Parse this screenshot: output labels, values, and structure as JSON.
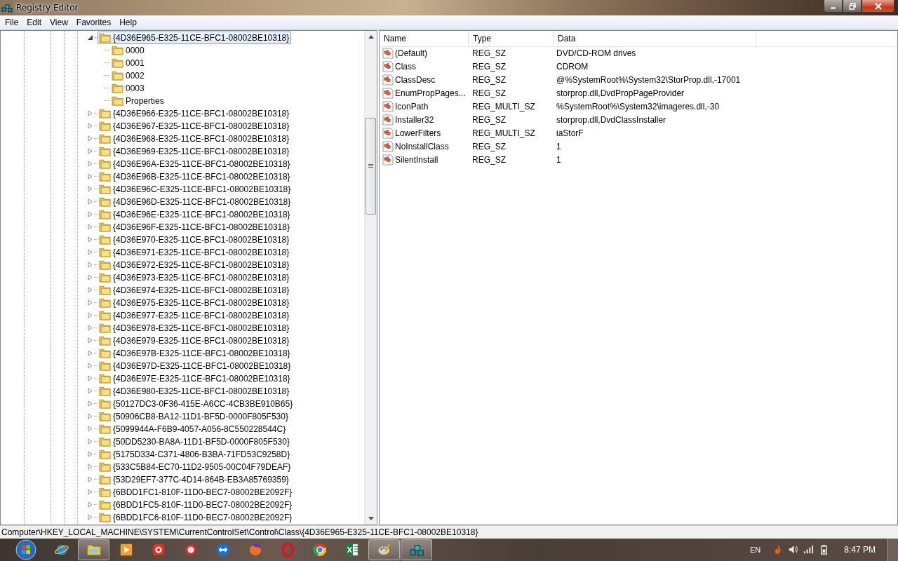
{
  "window": {
    "title": "Registry Editor"
  },
  "menu": [
    "File",
    "Edit",
    "View",
    "Favorites",
    "Help"
  ],
  "tree": {
    "items": [
      {
        "label": "{4D36E965-E325-11CE-BFC1-08002BE10318}",
        "expanded": true,
        "selected": true,
        "children": [
          {
            "label": "0000",
            "selected": false
          },
          {
            "label": "0001",
            "selected": false
          },
          {
            "label": "0002",
            "selected": false
          },
          {
            "label": "0003",
            "selected": false
          },
          {
            "label": "Properties",
            "selected": false
          }
        ]
      },
      {
        "label": "{4D36E966-E325-11CE-BFC1-08002BE10318}",
        "expanded": false,
        "selected": false
      },
      {
        "label": "{4D36E967-E325-11CE-BFC1-08002BE10318}",
        "expanded": false,
        "selected": false
      },
      {
        "label": "{4D36E968-E325-11CE-BFC1-08002BE10318}",
        "expanded": false,
        "selected": false
      },
      {
        "label": "{4D36E969-E325-11CE-BFC1-08002BE10318}",
        "expanded": false,
        "selected": false
      },
      {
        "label": "{4D36E96A-E325-11CE-BFC1-08002BE10318}",
        "expanded": false,
        "selected": false
      },
      {
        "label": "{4D36E96B-E325-11CE-BFC1-08002BE10318}",
        "expanded": false,
        "selected": false
      },
      {
        "label": "{4D36E96C-E325-11CE-BFC1-08002BE10318}",
        "expanded": false,
        "selected": false
      },
      {
        "label": "{4D36E96D-E325-11CE-BFC1-08002BE10318}",
        "expanded": false,
        "selected": false
      },
      {
        "label": "{4D36E96E-E325-11CE-BFC1-08002BE10318}",
        "expanded": false,
        "selected": false
      },
      {
        "label": "{4D36E96F-E325-11CE-BFC1-08002BE10318}",
        "expanded": false,
        "selected": false
      },
      {
        "label": "{4D36E970-E325-11CE-BFC1-08002BE10318}",
        "expanded": false,
        "selected": false
      },
      {
        "label": "{4D36E971-E325-11CE-BFC1-08002BE10318}",
        "expanded": false,
        "selected": false
      },
      {
        "label": "{4D36E972-E325-11CE-BFC1-08002BE10318}",
        "expanded": false,
        "selected": false
      },
      {
        "label": "{4D36E973-E325-11CE-BFC1-08002BE10318}",
        "expanded": false,
        "selected": false
      },
      {
        "label": "{4D36E974-E325-11CE-BFC1-08002BE10318}",
        "expanded": false,
        "selected": false
      },
      {
        "label": "{4D36E975-E325-11CE-BFC1-08002BE10318}",
        "expanded": false,
        "selected": false
      },
      {
        "label": "{4D36E977-E325-11CE-BFC1-08002BE10318}",
        "expanded": false,
        "selected": false
      },
      {
        "label": "{4D36E978-E325-11CE-BFC1-08002BE10318}",
        "expanded": false,
        "selected": false
      },
      {
        "label": "{4D36E979-E325-11CE-BFC1-08002BE10318}",
        "expanded": false,
        "selected": false
      },
      {
        "label": "{4D36E97B-E325-11CE-BFC1-08002BE10318}",
        "expanded": false,
        "selected": false
      },
      {
        "label": "{4D36E97D-E325-11CE-BFC1-08002BE10318}",
        "expanded": false,
        "selected": false
      },
      {
        "label": "{4D36E97E-E325-11CE-BFC1-08002BE10318}",
        "expanded": false,
        "selected": false
      },
      {
        "label": "{4D36E980-E325-11CE-BFC1-08002BE10318}",
        "expanded": false,
        "selected": false
      },
      {
        "label": "{50127DC3-0F36-415E-A6CC-4CB3BE910B65}",
        "expanded": false,
        "selected": false
      },
      {
        "label": "{50906CB8-BA12-11D1-BF5D-0000F805F530}",
        "expanded": false,
        "selected": false
      },
      {
        "label": "{5099944A-F6B9-4057-A056-8C550228544C}",
        "expanded": false,
        "selected": false
      },
      {
        "label": "{50DD5230-BA8A-11D1-BF5D-0000F805F530}",
        "expanded": false,
        "selected": false
      },
      {
        "label": "{5175D334-C371-4806-B3BA-71FD53C9258D}",
        "expanded": false,
        "selected": false
      },
      {
        "label": "{533C5B84-EC70-11D2-9505-00C04F79DEAF}",
        "expanded": false,
        "selected": false
      },
      {
        "label": "{53D29EF7-377C-4D14-864B-EB3A85769359}",
        "expanded": false,
        "selected": false
      },
      {
        "label": "{6BDD1FC1-810F-11D0-BEC7-08002BE2092F}",
        "expanded": false,
        "selected": false
      },
      {
        "label": "{6BDD1FC5-810F-11D0-BEC7-08002BE2092F}",
        "expanded": false,
        "selected": false
      },
      {
        "label": "{6BDD1FC6-810F-11D0-BEC7-08002BE2092F}",
        "expanded": false,
        "selected": false
      }
    ]
  },
  "values": {
    "columns": [
      "Name",
      "Type",
      "Data"
    ],
    "rows": [
      {
        "name": "(Default)",
        "type": "REG_SZ",
        "data": "DVD/CD-ROM drives"
      },
      {
        "name": "Class",
        "type": "REG_SZ",
        "data": "CDROM"
      },
      {
        "name": "ClassDesc",
        "type": "REG_SZ",
        "data": "@%SystemRoot%\\System32\\StorProp.dll,-17001"
      },
      {
        "name": "EnumPropPages...",
        "type": "REG_SZ",
        "data": "storprop.dll,DvdPropPageProvider"
      },
      {
        "name": "IconPath",
        "type": "REG_MULTI_SZ",
        "data": "%SystemRoot%\\System32\\imageres.dll,-30"
      },
      {
        "name": "Installer32",
        "type": "REG_SZ",
        "data": "storprop.dll,DvdClassInstaller"
      },
      {
        "name": "LowerFilters",
        "type": "REG_MULTI_SZ",
        "data": "iaStorF"
      },
      {
        "name": "NoInstallClass",
        "type": "REG_SZ",
        "data": "1"
      },
      {
        "name": "SilentInstall",
        "type": "REG_SZ",
        "data": "1"
      }
    ]
  },
  "status_bar": "Computer\\HKEY_LOCAL_MACHINE\\SYSTEM\\CurrentControlSet\\Control\\Class\\{4D36E965-E325-11CE-BFC1-08002BE10318}",
  "taskbar": {
    "apps": [
      {
        "kind": "browser",
        "open": false
      },
      {
        "kind": "folder",
        "open": true
      },
      {
        "kind": "player",
        "open": false
      },
      {
        "kind": "recorder",
        "open": false
      },
      {
        "kind": "badge",
        "open": false
      },
      {
        "kind": "remote",
        "open": false
      },
      {
        "kind": "fox",
        "open": false
      },
      {
        "kind": "ring",
        "open": false
      },
      {
        "kind": "wheel",
        "open": false
      },
      {
        "kind": "sheet",
        "open": false
      },
      {
        "kind": "palette",
        "open": true
      },
      {
        "kind": "cubes",
        "open": true
      }
    ],
    "tray": {
      "language": "EN",
      "time": "8:47 PM"
    }
  }
}
